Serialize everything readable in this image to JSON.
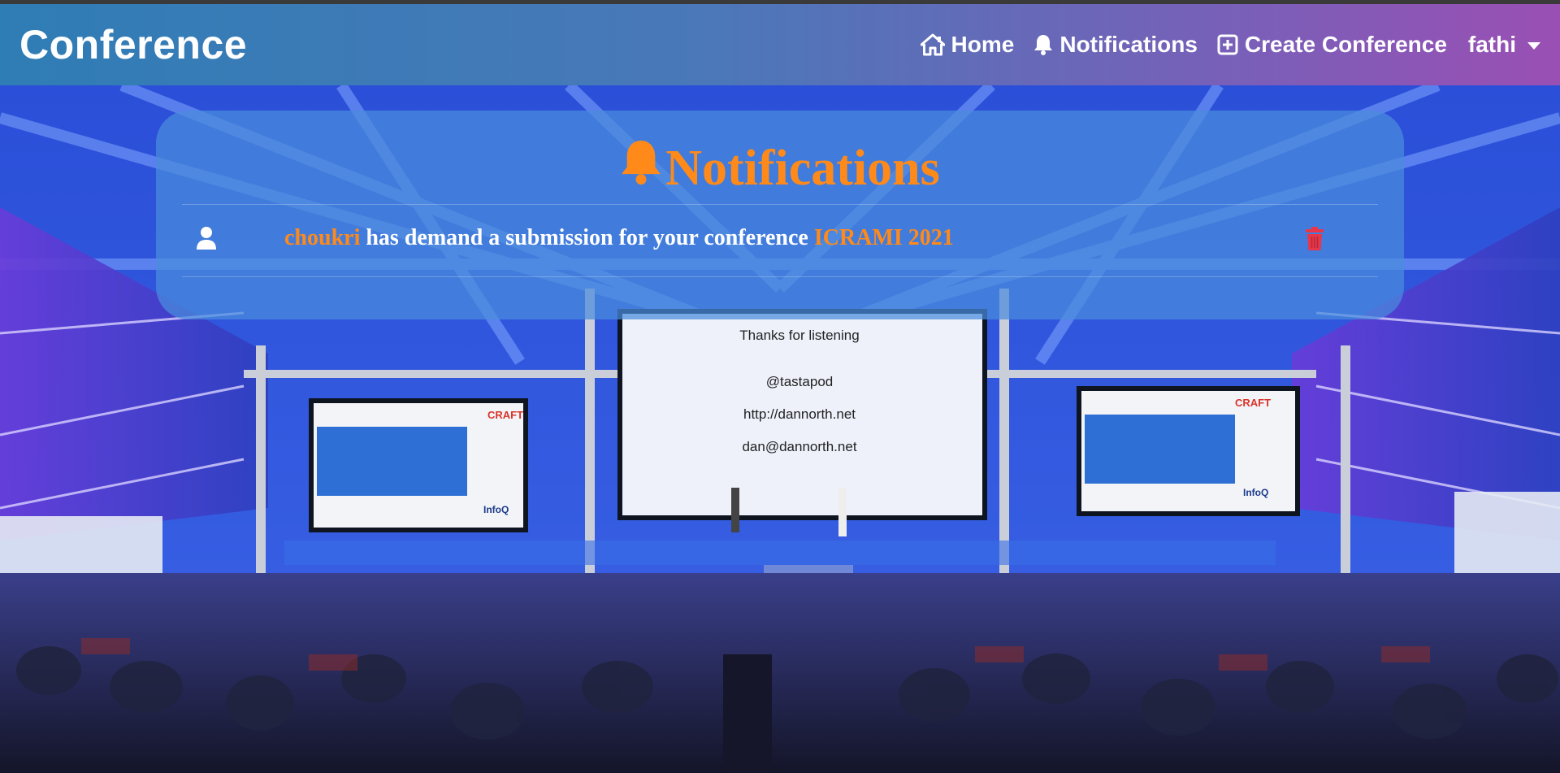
{
  "navbar": {
    "brand": "Conference",
    "links": [
      {
        "label": "Home",
        "icon": "home-icon"
      },
      {
        "label": "Notifications",
        "icon": "bell-icon"
      },
      {
        "label": "Create Conference",
        "icon": "plus-square-icon"
      }
    ],
    "user": "fathi"
  },
  "panel": {
    "title": "Notifications",
    "notifications": [
      {
        "user": "choukri",
        "message": "has demand a submission for your conference",
        "conference": "ICRAMI 2021"
      }
    ]
  },
  "background": {
    "screen_center": [
      "Thanks for listening",
      "@tastapod",
      "http://dannorth.net",
      "dan@dannorth.net"
    ],
    "screen_side_brand": "CRAFT",
    "screen_side_sponsor": "InfoQ"
  },
  "colors": {
    "accent": "#ff8a1a",
    "delete": "#e8364a",
    "navbar_start": "#2f7db5",
    "navbar_end": "#9a4fb4"
  }
}
